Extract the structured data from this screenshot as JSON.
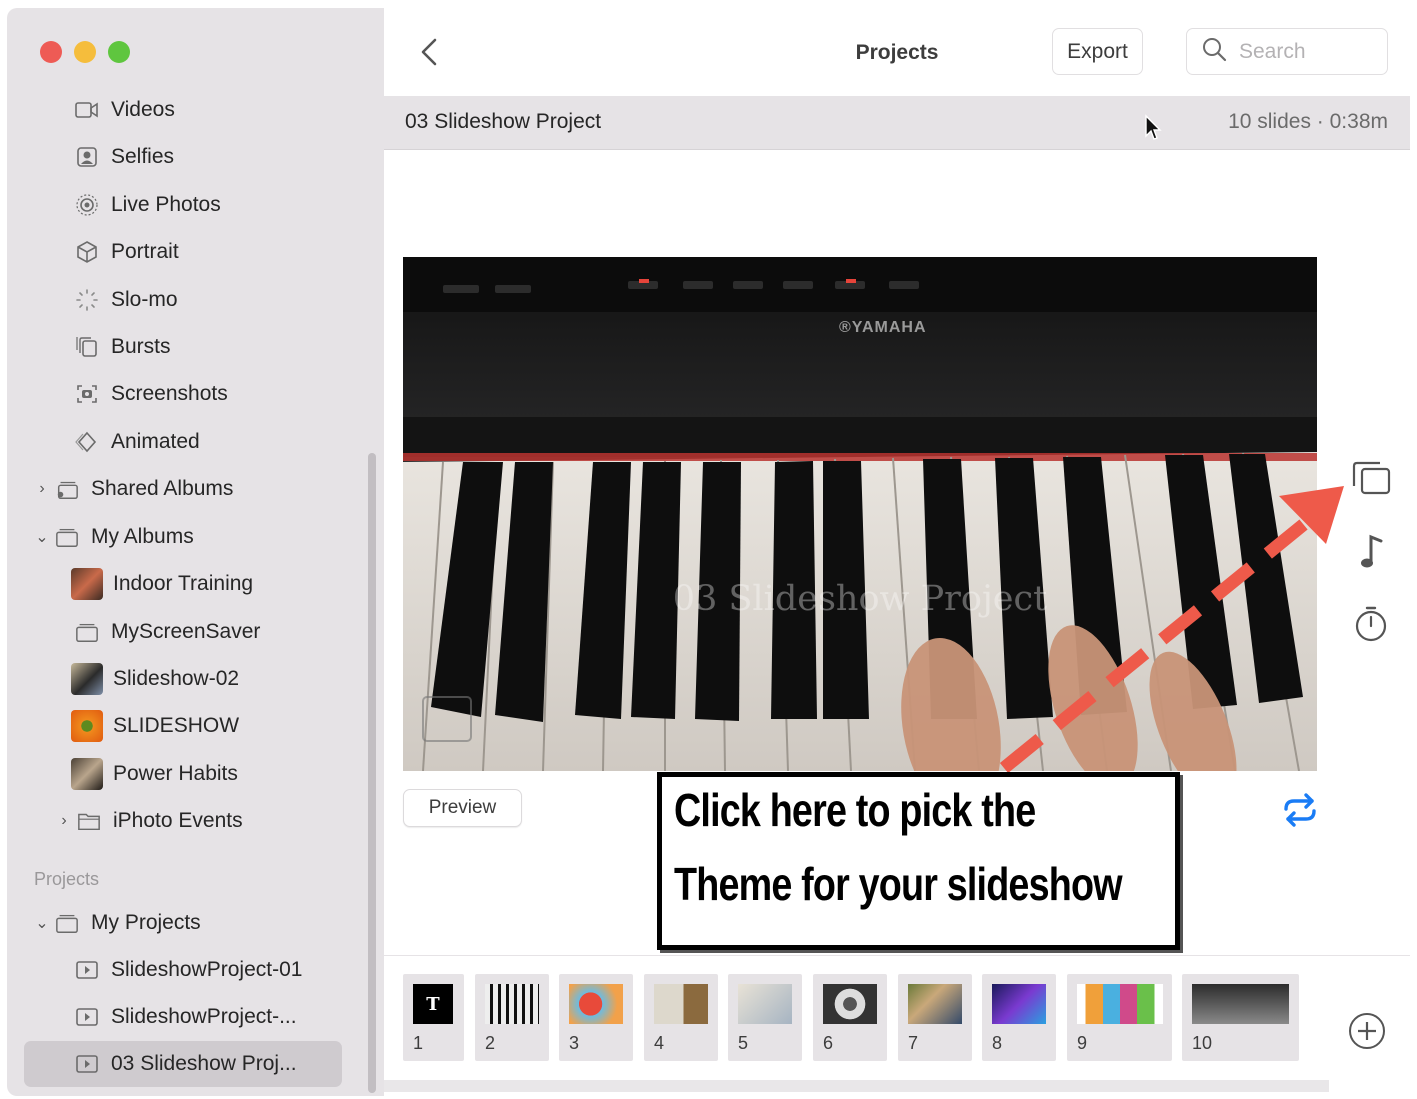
{
  "sidebar": {
    "items": [
      {
        "label": "Videos",
        "icon": "video-icon"
      },
      {
        "label": "Selfies",
        "icon": "selfie-icon"
      },
      {
        "label": "Live Photos",
        "icon": "live-photo-icon"
      },
      {
        "label": "Portrait",
        "icon": "cube-icon"
      },
      {
        "label": "Slo-mo",
        "icon": "slomo-icon"
      },
      {
        "label": "Bursts",
        "icon": "bursts-icon"
      },
      {
        "label": "Screenshots",
        "icon": "screenshot-icon"
      },
      {
        "label": "Animated",
        "icon": "animated-icon"
      },
      {
        "label": "Shared Albums",
        "icon": "shared-album-icon"
      },
      {
        "label": "My Albums",
        "icon": "album-icon"
      },
      {
        "label": "Indoor Training",
        "icon": "album-thumb"
      },
      {
        "label": "MyScreenSaver",
        "icon": "album-icon"
      },
      {
        "label": "Slideshow-02",
        "icon": "album-thumb"
      },
      {
        "label": "SLIDESHOW",
        "icon": "album-thumb"
      },
      {
        "label": "Power Habits",
        "icon": "album-thumb"
      },
      {
        "label": "iPhoto Events",
        "icon": "folder-icon"
      }
    ],
    "projects_header": "Projects",
    "projects": [
      {
        "label": "My Projects"
      },
      {
        "label": "SlideshowProject-01"
      },
      {
        "label": "SlideshowProject-..."
      },
      {
        "label": "03 Slideshow Proj..."
      }
    ]
  },
  "toolbar": {
    "title": "Projects",
    "export_label": "Export",
    "search_placeholder": "Search"
  },
  "project": {
    "name": "03 Slideshow Project",
    "info": "10 slides · 0:38m"
  },
  "slide": {
    "watermark": "03 Slideshow Project",
    "brand": "®YAMAHA"
  },
  "preview_label": "Preview",
  "callout": {
    "line1": "Click here to pick the",
    "line2": "Theme for your slideshow"
  },
  "filmstrip": {
    "numbers": [
      "1",
      "2",
      "3",
      "4",
      "5",
      "6",
      "7",
      "8",
      "9",
      "10"
    ],
    "first_thumb_text": "T"
  },
  "colors": {
    "accent": "#1a7cf5",
    "annotation_arrow": "#ee5a4a",
    "sidebar_bg": "#e6e3e6"
  }
}
